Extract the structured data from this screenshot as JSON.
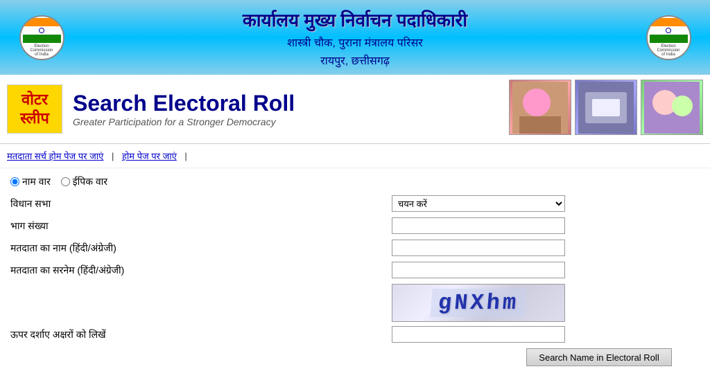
{
  "header": {
    "title_line1": "कार्यालय मुख्य निर्वाचन पदाधिकारी",
    "title_line2": "शास्त्री चौक, पुराना मंत्रालय परिसर",
    "title_line3": "रायपुर, छत्तीसगढ़"
  },
  "banner": {
    "voter_slip_line1": "वोटर",
    "voter_slip_line2": "स्लीप",
    "title": "Search Electoral Roll",
    "subtitle": "Greater Participation for a Stronger Democracy"
  },
  "nav": {
    "link1": "मतदाता सर्च होम पेज पर जाएं",
    "separator1": "|",
    "link2": "होम पेज पर जाएं",
    "separator2": "|"
  },
  "form": {
    "radio_naam": "नाम वार",
    "radio_epic": "ईपिक वार",
    "label_vidhan": "विधान सभा",
    "label_bhaag": "भाग संख्या",
    "label_naam": "मतदाता का नाम (हिंदी/अंग्रेजी)",
    "label_surname": "मतदाता का सरनेम (हिंदी/अंग्रेजी)",
    "label_captcha": "ऊपर दर्शाए अक्षरों को लिखें",
    "dropdown_placeholder": "चयन करें",
    "captcha_value": "gNXhm",
    "submit_button": "Search Name in Electoral Roll"
  }
}
